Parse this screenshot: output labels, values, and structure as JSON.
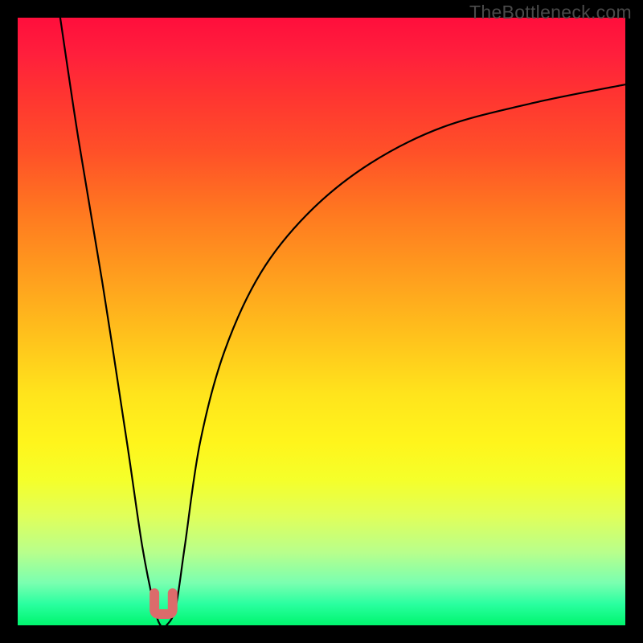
{
  "watermark": "TheBottleneck.com",
  "chart_data": {
    "type": "line",
    "title": "",
    "xlabel": "",
    "ylabel": "",
    "xlim": [
      0,
      100
    ],
    "ylim": [
      0,
      100
    ],
    "series": [
      {
        "name": "bottleneck-curve",
        "x": [
          7,
          10,
          14,
          18,
          20.5,
          22.5,
          23.5,
          24.5,
          26,
          27.5,
          30,
          34,
          40,
          48,
          58,
          70,
          85,
          100
        ],
        "y": [
          100,
          80,
          56,
          30,
          13,
          3,
          0,
          0,
          3,
          13,
          30,
          45,
          58,
          68,
          76,
          82,
          86,
          89
        ]
      }
    ],
    "marker": {
      "name": "minimum-marker",
      "x_range": [
        22.5,
        25.5
      ],
      "y": 0,
      "color": "#dc6b6b"
    },
    "gradient_stops": [
      {
        "pos": 0,
        "color": "#ff0e3c"
      },
      {
        "pos": 50,
        "color": "#ffc01c"
      },
      {
        "pos": 75,
        "color": "#ffff2a"
      },
      {
        "pos": 100,
        "color": "#00f56e"
      }
    ]
  }
}
